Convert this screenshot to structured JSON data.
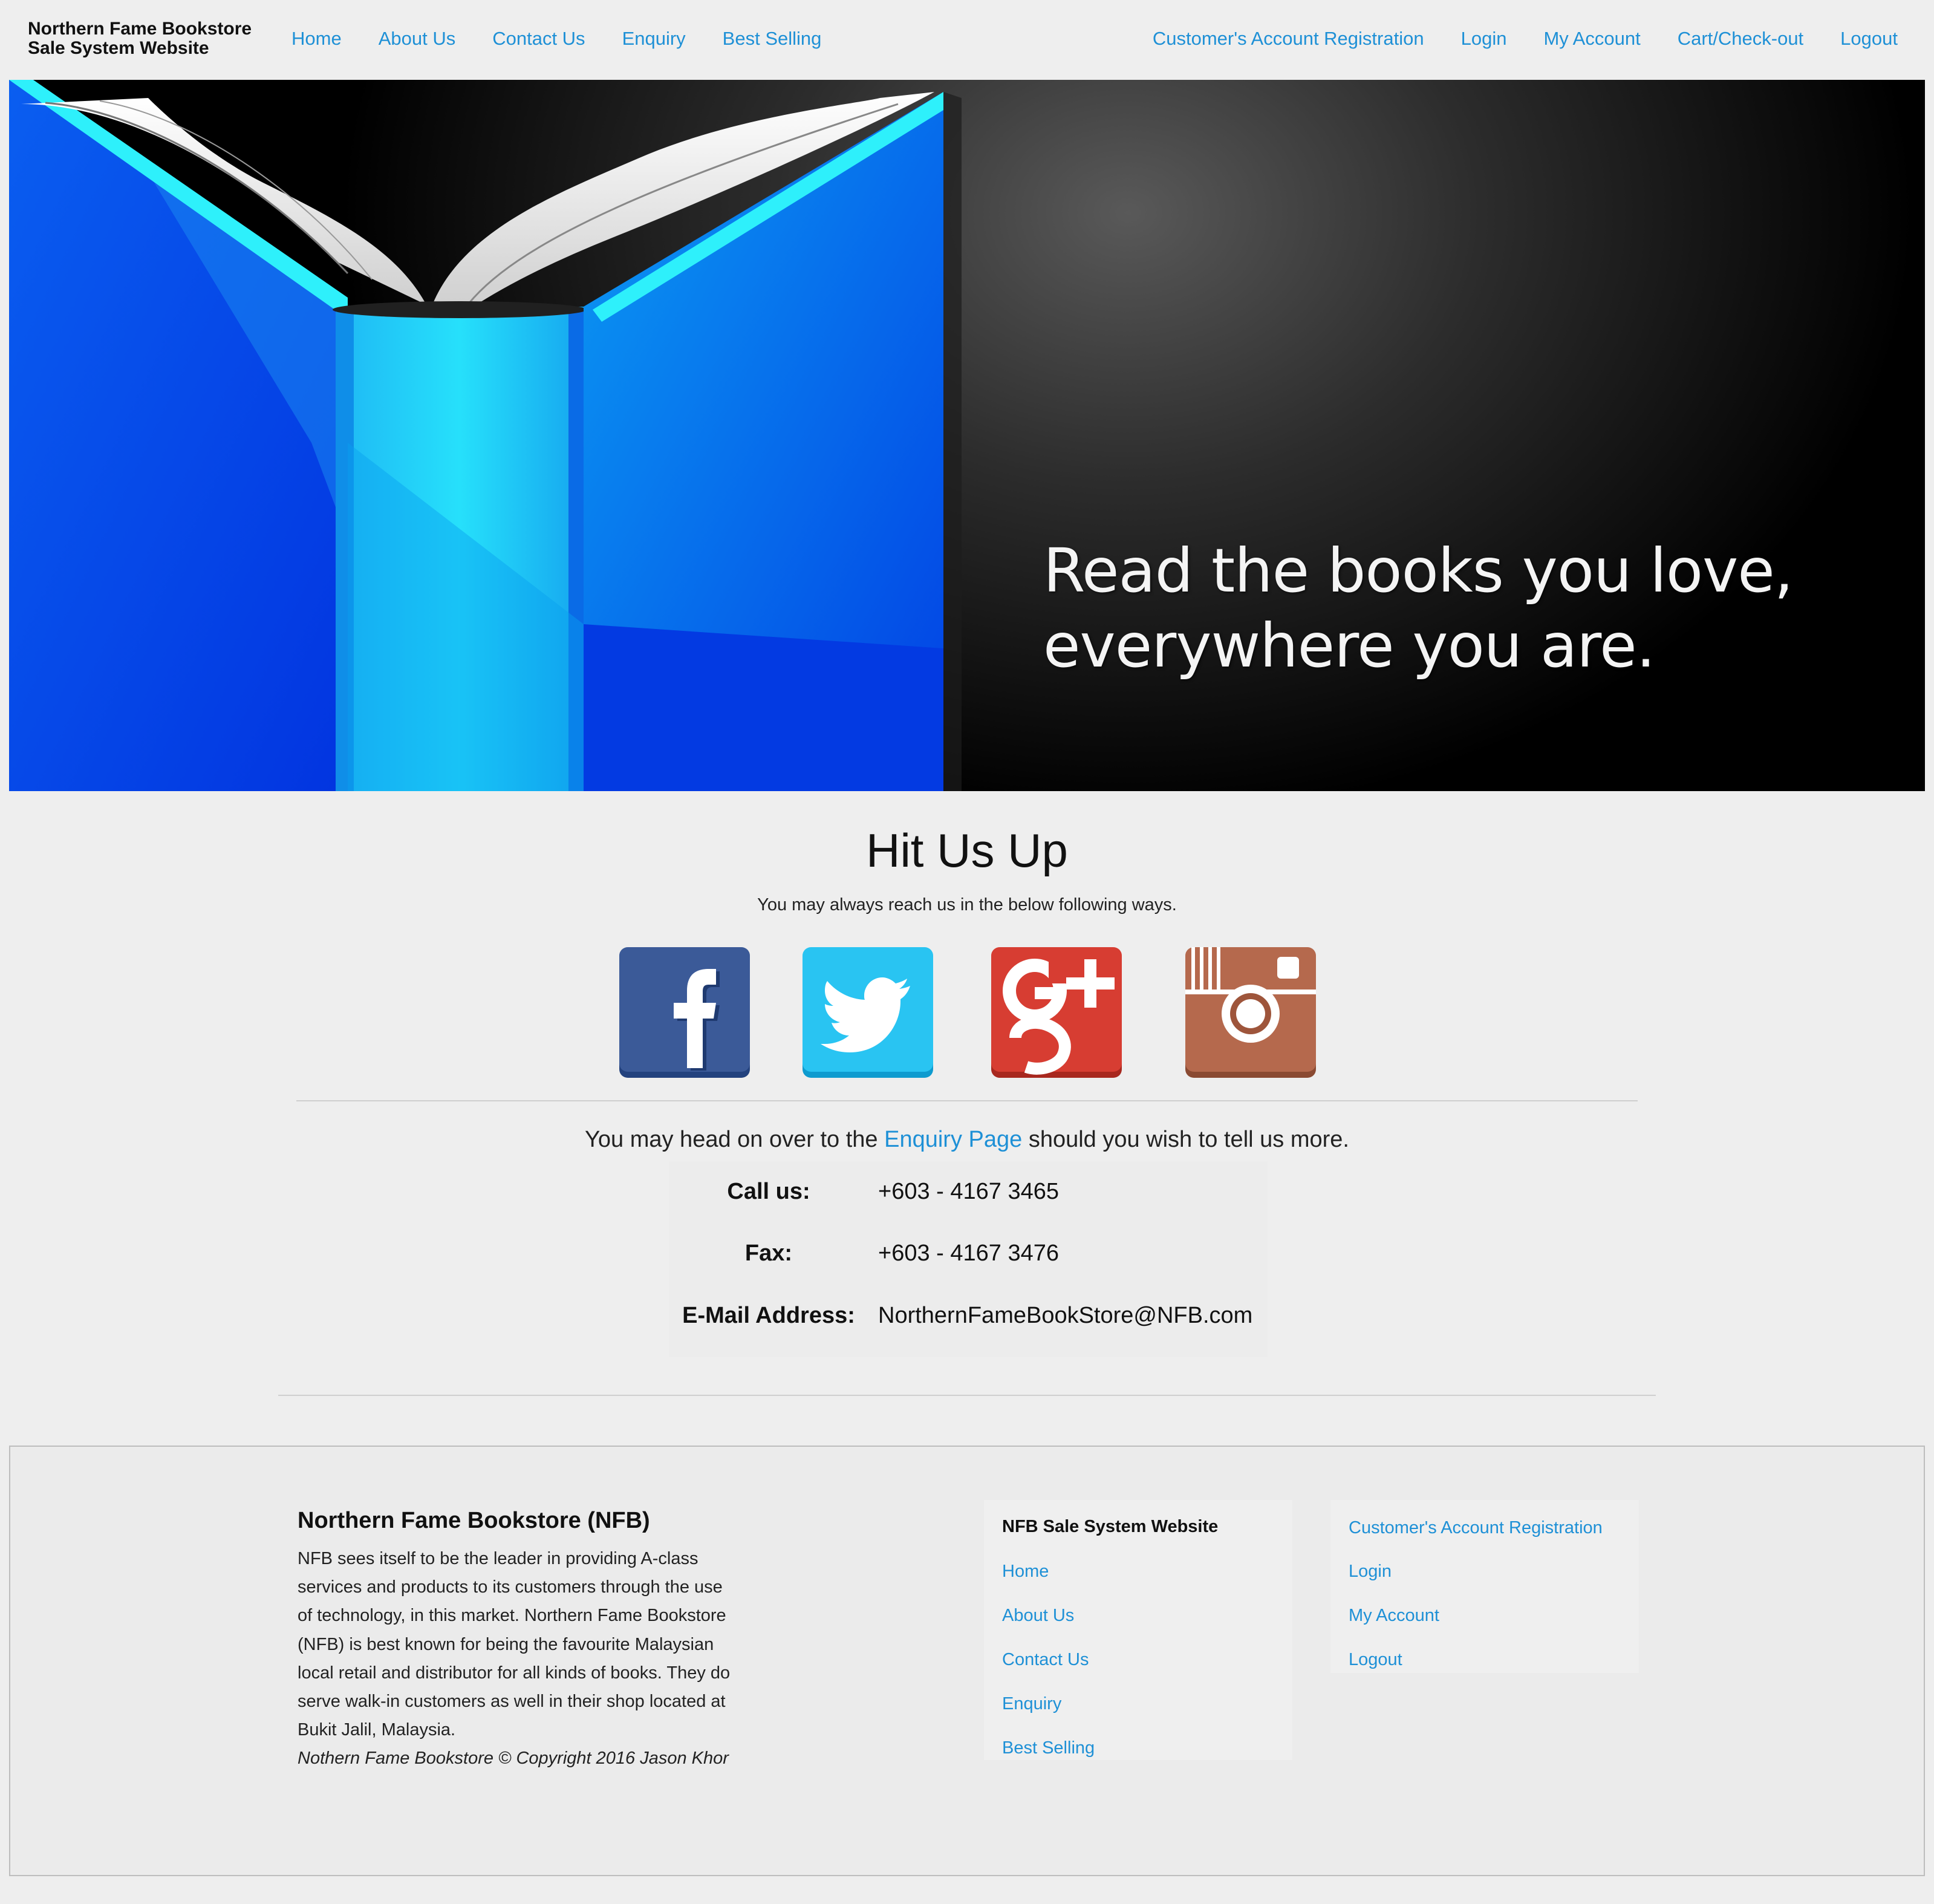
{
  "brand": {
    "line1": "Northern Fame Bookstore",
    "line2": "Sale System Website"
  },
  "nav": {
    "left": [
      "Home",
      "About Us",
      "Contact Us",
      "Enquiry",
      "Best Selling"
    ],
    "right": [
      "Customer's Account Registration",
      "Login",
      "My Account",
      "Cart/Check-out",
      "Logout"
    ]
  },
  "hero": {
    "line1": "Read the books you love,",
    "line2": "everywhere you are."
  },
  "contact": {
    "title": "Hit Us Up",
    "subtitle": "You may always reach us in the below following ways.",
    "social": [
      "facebook-icon",
      "twitter-icon",
      "google-plus-icon",
      "instagram-icon"
    ],
    "enquiry_prefix": "You may head on over to the",
    "enquiry_link": "Enquiry Page",
    "enquiry_suffix": "should you wish to tell us more.",
    "call_label": "Call us:",
    "call_value": "+603 - 4167 3465",
    "fax_label": "Fax:",
    "fax_value": "+603 - 4167 3476",
    "email_label": "E-Mail Address:",
    "email_value": "NorthernFameBookStore@NFB.com"
  },
  "footer": {
    "title": "Northern Fame Bookstore (NFB)",
    "about": "NFB sees itself to be the leader in providing A-class services and products to its customers through the use of technology, in this market. Northern Fame Bookstore (NFB) is best known for being the favourite Malaysian local retail and distributor for all kinds of books. They do serve walk-in customers as well in their shop located at Bukit Jalil, Malaysia.",
    "copyright": "Nothern Fame Bookstore © Copyright 2016 Jason Khor",
    "col1_heading": "NFB Sale System Website",
    "col1_links": [
      "Home",
      "About Us",
      "Contact Us",
      "Enquiry",
      "Best Selling"
    ],
    "col2_links": [
      "Customer's Account Registration",
      "Login",
      "My Account",
      "Logout"
    ]
  },
  "colors": {
    "link": "#1e90d6",
    "background": "#eeeeee",
    "facebook": "#3b5a98",
    "twitter": "#29c4f2",
    "google_plus": "#d73d32",
    "instagram": "#b5694d"
  }
}
